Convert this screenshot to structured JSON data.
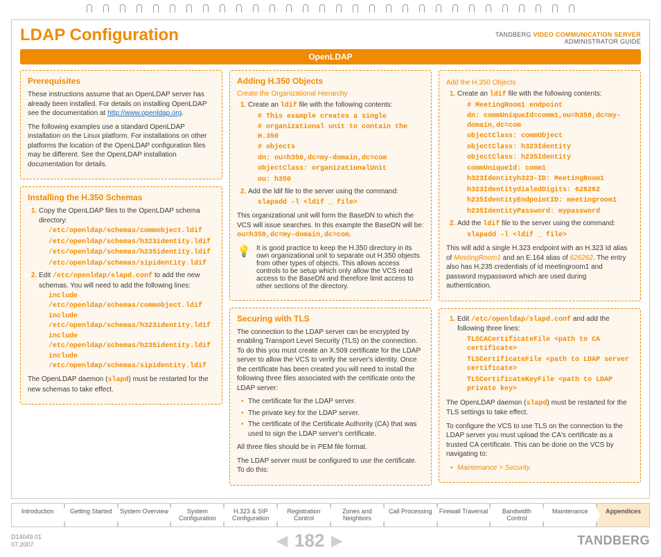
{
  "header": {
    "title": "LDAP Configuration",
    "product_line1_pre": "TANDBERG ",
    "product_line1_em": "VIDEO COMMUNICATION SERVER",
    "product_line2": "ADMINISTRATOR GUIDE"
  },
  "bar": "OpenLDAP",
  "left": {
    "prereq": {
      "title": "Prerequisites",
      "p1a": "These instructions assume that an OpenLDAP server has already been installed. For details on installing OpenLDAP see the documentation at ",
      "link": "http://www.openldap.org",
      "p1b": ".",
      "p2": "The following examples use a standard OpenLDAP installation on the Linux platform. For installations on other platforms the location of the OpenLDAP configuration files may be different. See the OpenLDAP installation documentation for details."
    },
    "install": {
      "title": "Installing the H.350 Schemas",
      "step1": "Copy the OpenLDAP files to the OpenLDAP schema directory:",
      "paths": [
        "/etc/openldap/schemas/commobject.ldif",
        "/etc/openldap/schemas/h323identity.ldif",
        "/etc/openldap/schemas/h235identity.ldif",
        "/etc/openldap/schemas/sipidentity.ldif"
      ],
      "step2a": "Edit ",
      "step2_code": "/etc/openldap/slapd.conf",
      "step2b": " to add the new schemas. You will need to add the following lines:",
      "includes": [
        "include /etc/openldap/schemas/commobject.ldif",
        "include /etc/openldap/schemas/h323identity.ldif",
        "include /etc/openldap/schemas/h235identity.ldif",
        "include /etc/openldap/schemas/sipidentity.ldif"
      ],
      "p3a": "The OpenLDAP daemon (",
      "p3_code": "slapd",
      "p3b": ") must be restarted for the new schemas to take effect."
    }
  },
  "mid": {
    "add": {
      "title": "Adding H.350 Objects",
      "sub1": "Create the Organizational Hierarchy",
      "s1a": "Create an ",
      "s1_code": "ldif",
      "s1b": " file with the following contents:",
      "block1": [
        "# This example creates a single",
        "# organizational unit to contain the H.350",
        "# objects",
        "dn: ou=h350,dc=my-domain,dc=com",
        "objectClass: organizationalUnit",
        "ou: h350"
      ],
      "s2": "Add the ldif file to the server using the command:",
      "cmd": "slapadd -l <ldif _ file>",
      "p_after": "This organizational unit will form the BaseDN to which the VCS will issue searches. In this example the BaseDN will be: ",
      "p_after_code": "ou=h350,dc=my-domain,dc=com",
      "p_after_dot": ".",
      "tip": "It is good practice to keep the H.350 directory in its own organizational unit to separate out H.350 objects from other types of objects. This allows access controls to be setup which only allow the VCS read access to the BaseDN and therefore limit access to other sections of the directory."
    },
    "tls": {
      "title": "Securing with TLS",
      "p1": "The connection to the LDAP server can be encrypted by enabling Transport Level Security (TLS) on the connection. To do this you must create an X.509 certificate for the LDAP server to allow the VCS to verify the server's identity. Once the certificate has been created you will need to install the following three files associated with the certificate onto the LDAP server:",
      "bullets": [
        "The certificate for the LDAP server.",
        "The private key for the LDAP server.",
        "The certificate of the Certificate Authority (CA) that was used to sign the LDAP server's certificate."
      ],
      "p2": "All three files should be in PEM file format.",
      "p3": "The LDAP server must be configured to use the certificate. To do this:"
    }
  },
  "right": {
    "addobj": {
      "sub": "Add the H.350 Objects",
      "s1a": "Create an ",
      "s1_code": "ldif",
      "s1b": " file with the following contents:",
      "block": [
        "# MeetingRoom1 endpoint",
        "dn: commUniqueId=comm1,ou=h350,dc=my-domain,dc=com",
        "objectClass: commObject",
        "objectClass: h323Identity",
        "objectClass: h235Identity",
        "commUniqueId: comm1",
        "h323Identityh323-ID: MeetingRoom1",
        "h323IdentitydialedDigits: 626262",
        "h235IdentityEndpointID: meetingroom1",
        "h235IdentityPassword: mypassword"
      ],
      "s2a": "Add the ",
      "s2_code": "ldif",
      "s2b": " file to the server using the command:",
      "cmd": "slapadd -l <ldif _ file>",
      "p_a": "This will add a single H.323 endpoint with an H.323 Id alias of ",
      "p_link1": "MeetingRoom1",
      "p_b": " and an E.164 alias of ",
      "p_link2": "626262",
      "p_c": ". The entry also has H.235 credentials of id meetingroom1 and password mypassword which are used during authentication."
    },
    "tls": {
      "s1a": "Edit ",
      "s1_code": "/etc/openldap/slapd.conf",
      "s1b": " and add the following three lines:",
      "lines": [
        "TLSCACertificateFile <path to CA certificate>",
        "TLSCertificateFile <path to LDAP server certificate>",
        "TLSCertificateKeyFile <path to LDAP private key>"
      ],
      "p2a": "The OpenLDAP daemon (",
      "p2_code": "slapd",
      "p2b": ") must be restarted for the TLS settings to take effect.",
      "p3": "To configure the VCS to use TLS on the connection to the LDAP server you must upload the CA's certificate as a trusted CA certificate. This can be done on the VCS by navigating to:",
      "nav": "Maintenance > Security."
    }
  },
  "tabs": [
    "Introduction",
    "Getting Started",
    "System Overview",
    "System Configuration",
    "H.323 & SIP Configuration",
    "Registration Control",
    "Zones and Neighbors",
    "Call Processing",
    "Firewall Traversal",
    "Bandwidth Control",
    "Maintenance",
    "Appendices"
  ],
  "footer": {
    "doc_id": "D14049.01",
    "date": "07.2007",
    "page": "182",
    "brand": "TANDBERG"
  }
}
